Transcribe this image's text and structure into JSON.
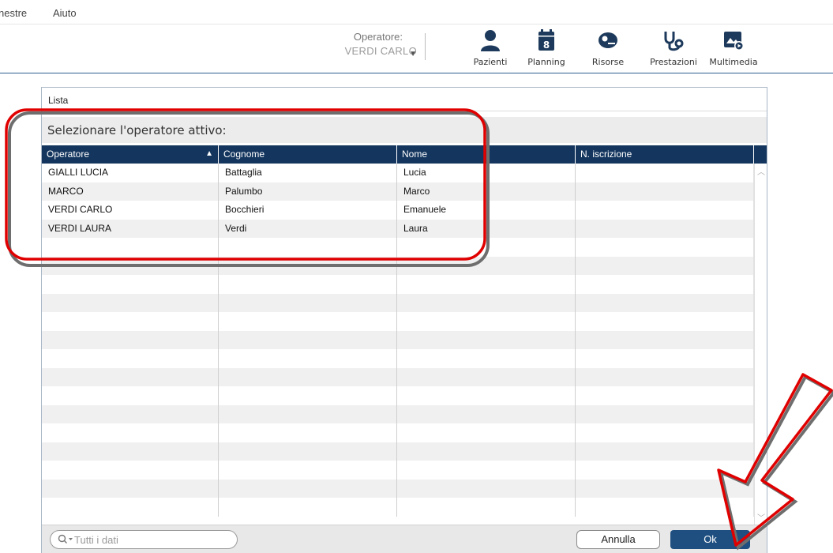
{
  "menu": {
    "items": [
      "nestre",
      "Aiuto"
    ]
  },
  "toolbar": {
    "operator_label": "Operatore:",
    "operator_value": "VERDI CARLO",
    "buttons": [
      {
        "label": "Pazienti",
        "icon": "person-icon"
      },
      {
        "label": "Planning",
        "icon": "calendar-icon",
        "badge": "8"
      },
      {
        "label": "Risorse",
        "icon": "resources-icon"
      },
      {
        "label": "Prestazioni",
        "icon": "stethoscope-icon"
      },
      {
        "label": "Multimedia",
        "icon": "multimedia-icon"
      }
    ],
    "accent_color": "#1d3a5c"
  },
  "dialog": {
    "title": "Lista",
    "prompt": "Selezionare l'operatore attivo:",
    "columns": [
      "Operatore",
      "Cognome",
      "Nome",
      "N. iscrizione"
    ],
    "sorted_column": "Operatore",
    "rows": [
      [
        "GIALLI LUCIA",
        "Battaglia",
        "Lucia",
        ""
      ],
      [
        "MARCO",
        "Palumbo",
        "Marco",
        ""
      ],
      [
        "VERDI CARLO",
        "Bocchieri",
        "Emanuele",
        ""
      ],
      [
        "VERDI LAURA",
        "Verdi",
        "Laura",
        ""
      ]
    ],
    "search_placeholder": "Tutti i dati",
    "cancel_label": "Annulla",
    "ok_label": "Ok",
    "header_color": "#14365e"
  },
  "annotations": {
    "color": "#e00000"
  }
}
